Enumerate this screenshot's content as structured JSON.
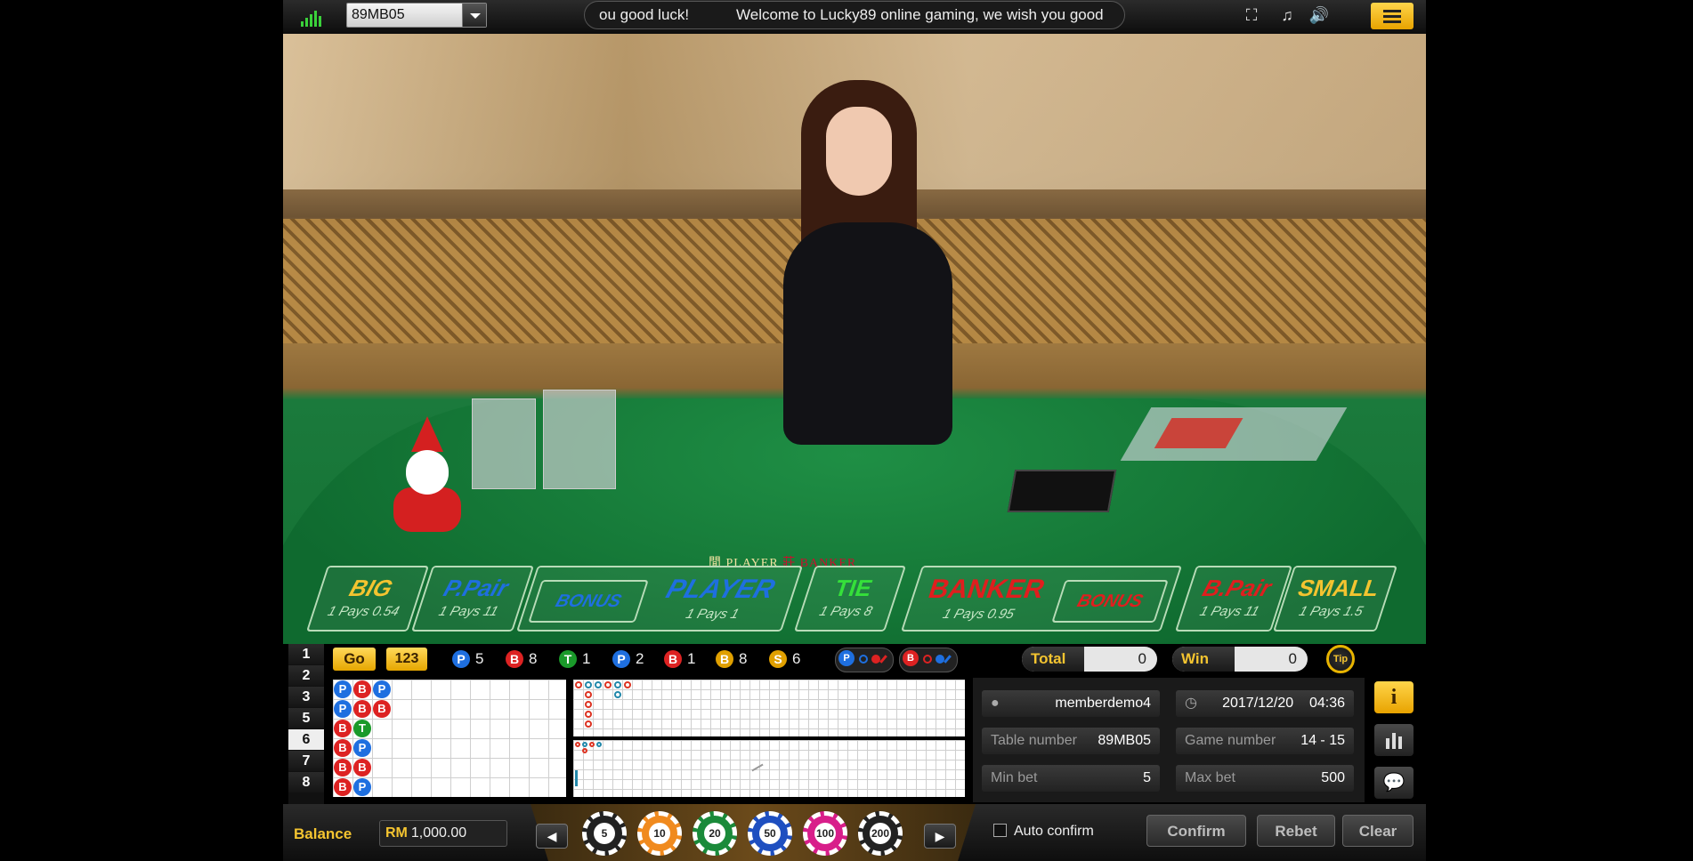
{
  "topbar": {
    "table_select_value": "89MB05",
    "marquee_tail": "ou good luck!",
    "marquee_text": "Welcome to Lucky89 online gaming, we wish you good"
  },
  "table_felt": {
    "player": "閒  PLAYER",
    "banker": "莊  BANKER"
  },
  "bet_zones": [
    {
      "name": "BIG",
      "pays": "1 Pays 0.54",
      "color": "#f4c430"
    },
    {
      "name": "P.Pair",
      "pays": "1 Pays 11",
      "color": "#1e6fe0"
    },
    {
      "name": "BONUS",
      "color": "#1e6fe0"
    },
    {
      "name": "PLAYER",
      "pays": "1 Pays 1",
      "color": "#1e6fe0"
    },
    {
      "name": "TIE",
      "pays": "1 Pays 8",
      "color": "#35e03a"
    },
    {
      "name": "BANKER",
      "pays": "1 Pays 0.95",
      "color": "#e01e1e"
    },
    {
      "name": "BONUS",
      "color": "#e01e1e"
    },
    {
      "name": "B.Pair",
      "pays": "1 Pays 11",
      "color": "#e01e1e"
    },
    {
      "name": "SMALL",
      "pays": "1 Pays 1.5",
      "color": "#f4c430"
    }
  ],
  "road": {
    "go_label": "Go",
    "numbers_label": "123",
    "stats": [
      {
        "icon": "P",
        "color": "#1e6fe0",
        "value": "5"
      },
      {
        "icon": "B",
        "color": "#d22",
        "value": "8"
      },
      {
        "icon": "T",
        "color": "#1a9a2a",
        "value": "1"
      },
      {
        "icon": "P",
        "color": "#1e6fe0",
        "value": "2"
      },
      {
        "icon": "B",
        "color": "#d22",
        "value": "1"
      },
      {
        "icon": "B",
        "color": "#e0a000",
        "value": "8"
      },
      {
        "icon": "S",
        "color": "#e0a000",
        "value": "6"
      }
    ],
    "predict_player": "P",
    "predict_banker": "B",
    "table_numbers": [
      "1",
      "2",
      "3",
      "5",
      "6",
      "7",
      "8"
    ],
    "selected_number": "6"
  },
  "totals": {
    "total_label": "Total",
    "total_value": "0",
    "win_label": "Win",
    "win_value": "0",
    "tip_label": "Tip"
  },
  "bead_road": [
    [
      "P",
      "B",
      "P"
    ],
    [
      "P",
      "B",
      "B"
    ],
    [
      "B",
      "T"
    ],
    [
      "B",
      "P"
    ],
    [
      "B",
      "B"
    ],
    [
      "B",
      "P"
    ]
  ],
  "info": {
    "username": "memberdemo4",
    "date": "2017/12/20",
    "time": "04:36",
    "table_number_label": "Table number",
    "table_number": "89MB05",
    "game_number_label": "Game number",
    "game_number": "14 - 15",
    "min_bet_label": "Min bet",
    "min_bet": "5",
    "max_bet_label": "Max bet",
    "max_bet": "500"
  },
  "bottom": {
    "balance_label": "Balance",
    "currency": "RM",
    "balance_value": "1,000.00",
    "chips": [
      "5",
      "10",
      "20",
      "50",
      "100",
      "200"
    ],
    "auto_confirm_label": "Auto confirm",
    "confirm_label": "Confirm",
    "rebet_label": "Rebet",
    "clear_label": "Clear"
  }
}
